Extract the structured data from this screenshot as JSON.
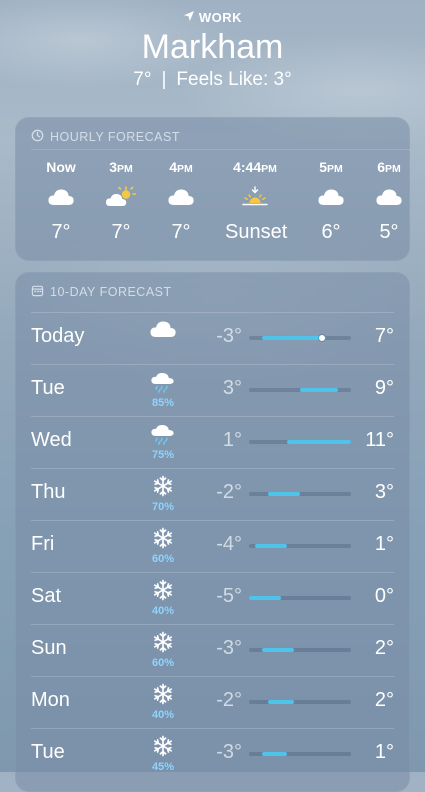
{
  "location": {
    "label": "WORK",
    "city": "Markham",
    "current_temp": "7°",
    "separator": "|",
    "feels_like": "Feels Like: 3°"
  },
  "hourly": {
    "title": "HOURLY FORECAST",
    "items": [
      {
        "time": "Now",
        "suffix": "",
        "icon": "cloud-icon",
        "value": "7°"
      },
      {
        "time": "3",
        "suffix": "PM",
        "icon": "partly-sunny-icon",
        "value": "7°"
      },
      {
        "time": "4",
        "suffix": "PM",
        "icon": "cloud-icon",
        "value": "7°"
      },
      {
        "time": "4:44",
        "suffix": "PM",
        "icon": "sunset-icon",
        "value": "Sunset"
      },
      {
        "time": "5",
        "suffix": "PM",
        "icon": "cloud-icon",
        "value": "6°"
      },
      {
        "time": "6",
        "suffix": "PM",
        "icon": "cloud-icon",
        "value": "5°"
      }
    ]
  },
  "daily": {
    "title": "10-DAY FORECAST",
    "range_min": -5,
    "range_max": 11,
    "items": [
      {
        "day": "Today",
        "icon": "cloud-icon",
        "precip": "",
        "low": "-3°",
        "high": "7°",
        "lo": -3,
        "hi": 7,
        "current": 6.5
      },
      {
        "day": "Tue",
        "icon": "rain-cloud-icon",
        "precip": "85%",
        "low": "3°",
        "high": "9°",
        "lo": 3,
        "hi": 9
      },
      {
        "day": "Wed",
        "icon": "rain-cloud-icon",
        "precip": "75%",
        "low": "1°",
        "high": "11°",
        "lo": 1,
        "hi": 11
      },
      {
        "day": "Thu",
        "icon": "snowflake-icon",
        "precip": "70%",
        "low": "-2°",
        "high": "3°",
        "lo": -2,
        "hi": 3
      },
      {
        "day": "Fri",
        "icon": "snowflake-icon",
        "precip": "60%",
        "low": "-4°",
        "high": "1°",
        "lo": -4,
        "hi": 1
      },
      {
        "day": "Sat",
        "icon": "snowflake-icon",
        "precip": "40%",
        "low": "-5°",
        "high": "0°",
        "lo": -5,
        "hi": 0
      },
      {
        "day": "Sun",
        "icon": "snowflake-icon",
        "precip": "60%",
        "low": "-3°",
        "high": "2°",
        "lo": -3,
        "hi": 2
      },
      {
        "day": "Mon",
        "icon": "snowflake-icon",
        "precip": "40%",
        "low": "-2°",
        "high": "2°",
        "lo": -2,
        "hi": 2
      },
      {
        "day": "Tue",
        "icon": "snowflake-icon",
        "precip": "45%",
        "low": "-3°",
        "high": "1°",
        "lo": -3,
        "hi": 1
      }
    ]
  },
  "colors": {
    "bar_fill": "#4fc3ea",
    "precip_text": "#8fd3ff",
    "sun": "#f5c842"
  }
}
